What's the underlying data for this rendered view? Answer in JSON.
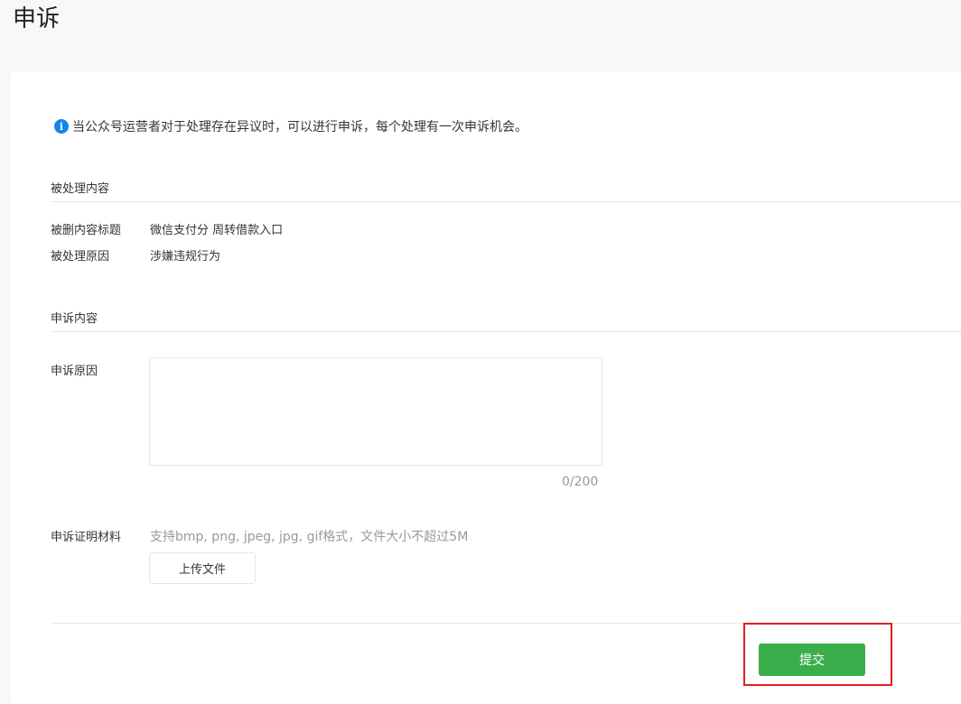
{
  "page": {
    "title": "申诉"
  },
  "notice": {
    "icon": "info-icon",
    "text": "当公众号运营者对于处理存在异议时，可以进行申诉，每个处理有一次申诉机会。"
  },
  "processed_section": {
    "title": "被处理内容",
    "rows": [
      {
        "label": "被删内容标题",
        "value": "微信支付分 周转借款入口"
      },
      {
        "label": "被处理原因",
        "value": "涉嫌违规行为"
      }
    ]
  },
  "appeal_section": {
    "title": "申诉内容",
    "reason_label": "申诉原因",
    "reason_value": "",
    "counter": "0/200",
    "evidence_label": "申诉证明材料",
    "evidence_hint": "支持bmp, png, jpeg, jpg, gif格式，文件大小不超过5M",
    "upload_label": "上传文件"
  },
  "actions": {
    "submit_label": "提交"
  },
  "colors": {
    "accent_green": "#3aae4a",
    "info_blue": "#1485ee",
    "highlight_red": "#e02020"
  }
}
